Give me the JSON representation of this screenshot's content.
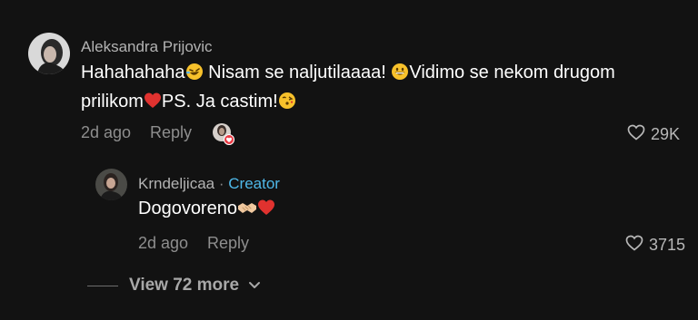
{
  "comment": {
    "author": "Aleksandra Prijovic",
    "text": {
      "part1": "Hahahahaha",
      "part2": " Nisam se naljutilaaaa! ",
      "part3": "Vidimo se nekom drugom prilikom",
      "part4": "PS. Ja castim!"
    },
    "time": "2d ago",
    "reply_label": "Reply",
    "likes": "29K",
    "icons": [
      "rofl-emoji",
      "grin-emoji",
      "heart-emoji",
      "kiss-emoji",
      "creator-liked-badge",
      "heart-outline-icon"
    ]
  },
  "reply": {
    "author": "Krndeljicaa",
    "separator": "·",
    "badge": "Creator",
    "text": "Dogovoreno",
    "time": "2d ago",
    "reply_label": "Reply",
    "likes": "3715",
    "icons": [
      "handshake-emoji",
      "heart-emoji",
      "heart-outline-icon"
    ]
  },
  "view_more": {
    "label": "View 72 more",
    "icon": "chevron-down-icon"
  },
  "colors": {
    "background": "#121212",
    "creator": "#4fb8e8",
    "heart": "#e0322f"
  }
}
